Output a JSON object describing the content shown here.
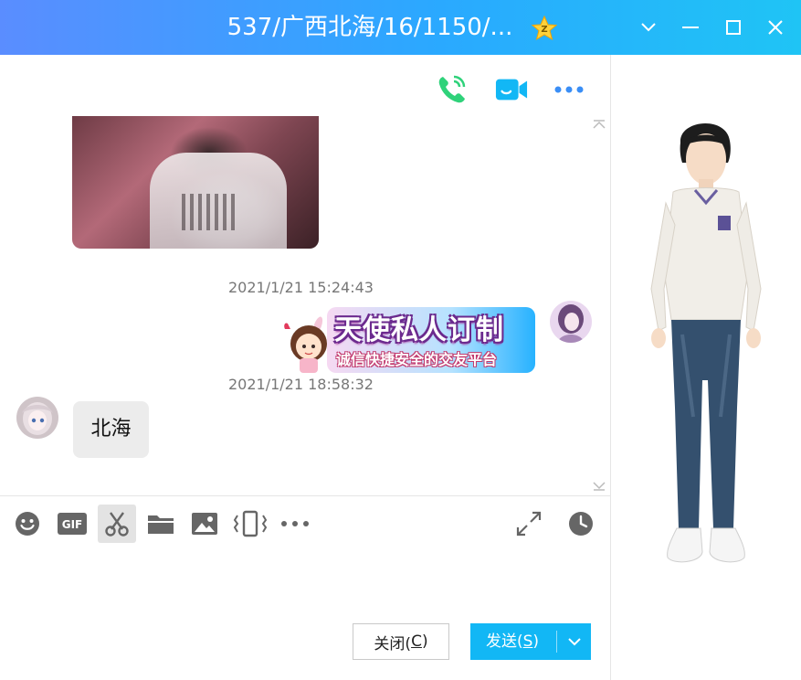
{
  "window": {
    "title": "537/广西北海/16/1150/..."
  },
  "messages": [
    {
      "type": "image",
      "from": "me"
    },
    {
      "type": "timestamp",
      "text": "2021/1/21 15:24:43"
    },
    {
      "type": "sticker",
      "from": "me",
      "line1": "天使私人订制",
      "line2": "诚信快捷安全的交友平台"
    },
    {
      "type": "timestamp",
      "text": "2021/1/21 18:58:32"
    },
    {
      "type": "text",
      "from": "contact",
      "text": "北海"
    }
  ],
  "toolbar": {
    "tools": [
      "emoji-icon",
      "gif-icon",
      "scissors-icon",
      "folder-icon",
      "image-icon",
      "shake-icon",
      "more-icon"
    ],
    "right": [
      "expand-icon",
      "history-clock-icon"
    ]
  },
  "buttons": {
    "close_prefix": "关闭(",
    "close_key": "C",
    "close_suffix": ")",
    "send_prefix": "发送(",
    "send_key": "S",
    "send_suffix": ")"
  },
  "colors": {
    "accent": "#12b7f5",
    "titlebar_start": "#5a8dff",
    "titlebar_end": "#1fc4f5",
    "voice_call": "#2fd27a"
  }
}
